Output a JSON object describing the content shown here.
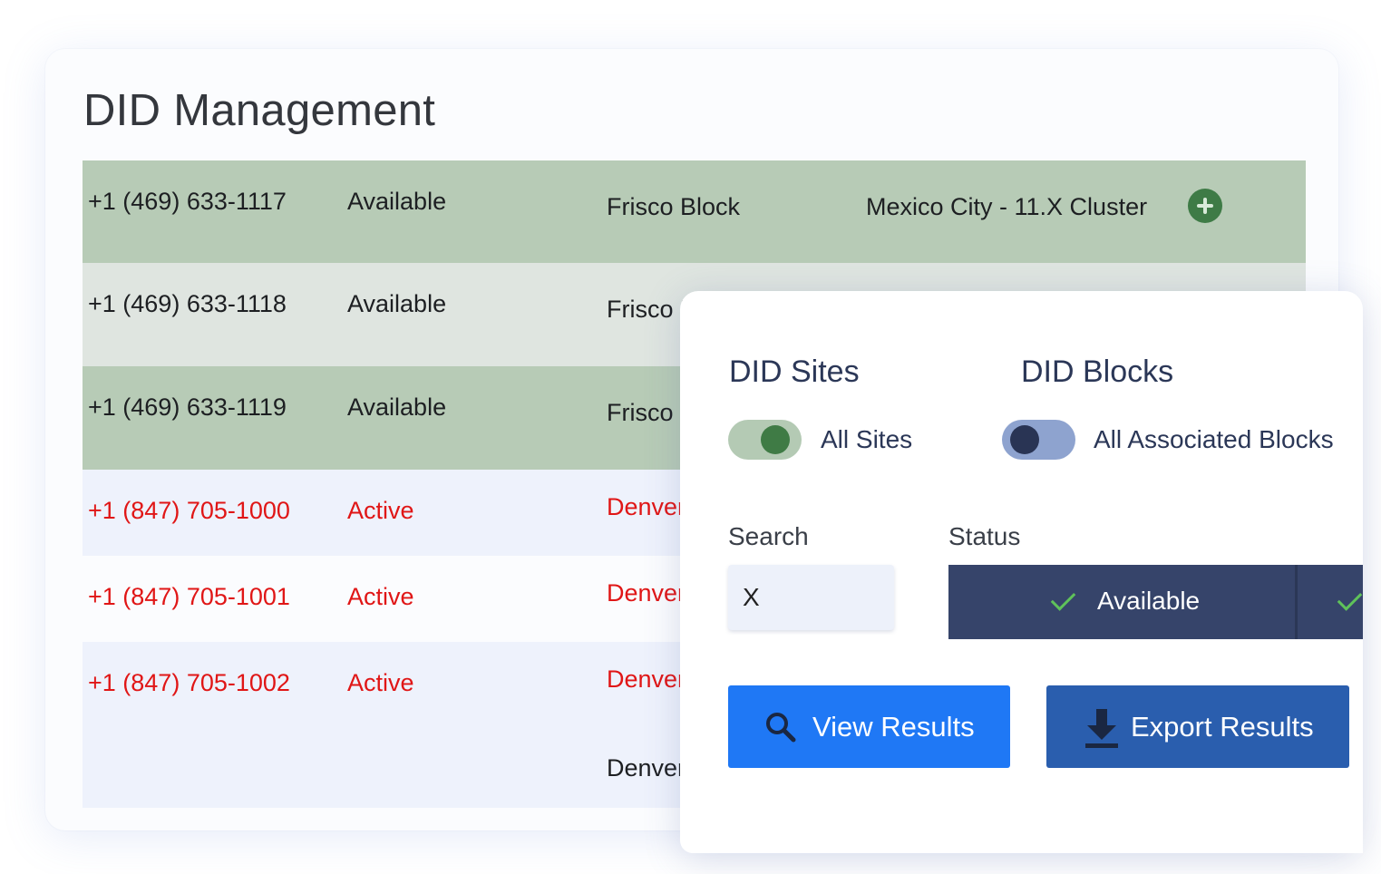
{
  "page": {
    "title": "DID Management"
  },
  "table": {
    "rows": [
      {
        "number": "+1 (469) 633-1117",
        "status": "Available",
        "block": "Frisco Block",
        "site": "Mexico City - 11.X Cluster"
      },
      {
        "number": "+1 (469) 633-1118",
        "status": "Available",
        "block": "Frisco B"
      },
      {
        "number": "+1 (469) 633-1119",
        "status": "Available",
        "block": "Frisco B"
      },
      {
        "number": "+1 (847) 705-1000",
        "status": "Active",
        "block": "Denver"
      },
      {
        "number": "+1 (847) 705-1001",
        "status": "Active",
        "block": "Denver"
      },
      {
        "number": "+1 (847) 705-1002",
        "status": "Active",
        "block": "Denver",
        "extra": "Denver"
      }
    ]
  },
  "filters": {
    "did_sites": {
      "title": "DID Sites",
      "toggle_label": "All Sites",
      "toggle_on": true
    },
    "did_blocks": {
      "title": "DID Blocks",
      "toggle_label": "All Associated Blocks",
      "toggle_on": false
    },
    "search": {
      "label": "Search",
      "value": "X"
    },
    "status": {
      "label": "Status",
      "selected": "Available"
    }
  },
  "actions": {
    "view_label": "View Results",
    "export_label": "Export Results"
  },
  "icons": {
    "add": "plus-circle-icon",
    "search": "search-icon",
    "export": "download-icon",
    "check": "check-icon"
  },
  "colors": {
    "row_highlight": "#b7cbb6",
    "active_text": "#e01616",
    "view_button": "#1f78f5",
    "export_button": "#2a5eae",
    "status_select": "#36446a"
  }
}
